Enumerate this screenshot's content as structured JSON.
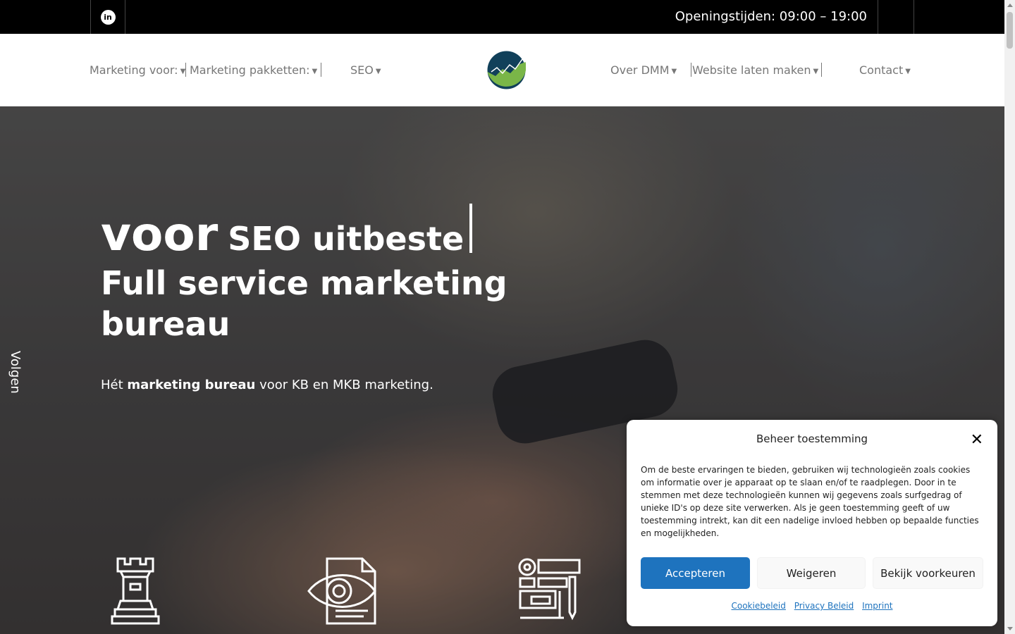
{
  "topbar": {
    "social_icon_label": "in",
    "social_icon": "linkedin-icon",
    "hours": "Openingstijden: 09:00 – 19:00"
  },
  "nav": {
    "items": [
      {
        "label": "Marketing voor:"
      },
      {
        "label": "Marketing pakketten:"
      },
      {
        "label": "SEO"
      },
      {
        "label": "Over DMM"
      },
      {
        "label": "Website laten maken"
      },
      {
        "label": "Contact"
      }
    ],
    "caret_icon": "caret-down-icon",
    "logo_icon": "growth-chart-logo"
  },
  "hero": {
    "typed_prefix": "voor",
    "typed_word": "SEO uitbeste",
    "heading": "Full service marketing bureau",
    "sub_pre": "Hét ",
    "sub_bold": "marketing bureau",
    "sub_post": " voor KB en MKB marketing.",
    "follow": "Volgen",
    "feature_icons": [
      "chess-rook-icon",
      "eye-document-icon",
      "web-layout-icon"
    ]
  },
  "cookie": {
    "title": "Beheer toestemming",
    "text": "Om de beste ervaringen te bieden, gebruiken wij technologieën zoals cookies om informatie over je apparaat op te slaan en/of te raadplegen. Door in te stemmen met deze technologieën kunnen wij gegevens zoals surfgedrag of unieke ID's op deze site verwerken. Als je geen toestemming geeft of uw toestemming intrekt, kan dit een nadelige invloed hebben op bepaalde functies en mogelijkheden.",
    "accept": "Accepteren",
    "deny": "Weigeren",
    "prefs": "Bekijk voorkeuren",
    "links": [
      "Cookiebeleid",
      "Privacy Beleid",
      "Imprint"
    ],
    "accent_color": "#1e73be"
  }
}
